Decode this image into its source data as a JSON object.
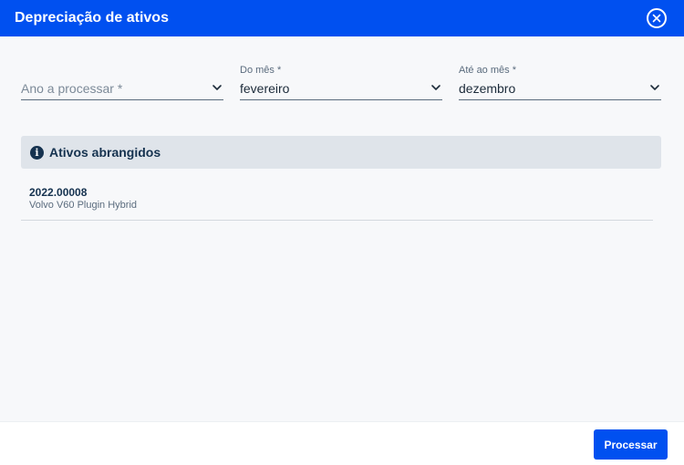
{
  "dialog": {
    "title": "Depreciação de ativos",
    "close_icon": "close-circle-icon"
  },
  "form": {
    "ano": {
      "placeholder": "Ano a processar *",
      "value": ""
    },
    "do_mes": {
      "label": "Do mês *",
      "value": "fevereiro"
    },
    "ate_mes": {
      "label": "Até ao mês *",
      "value": "dezembro"
    }
  },
  "assets_panel": {
    "title": "Ativos abrangidos",
    "icon": "info-icon",
    "items": [
      {
        "code": "2022.00008",
        "description": "Volvo V60 Plugin Hybrid"
      }
    ]
  },
  "footer": {
    "process_label": "Processar"
  },
  "colors": {
    "primary": "#0050f0",
    "info_bg": "#dfe4ea",
    "text_dark": "#15324f"
  }
}
